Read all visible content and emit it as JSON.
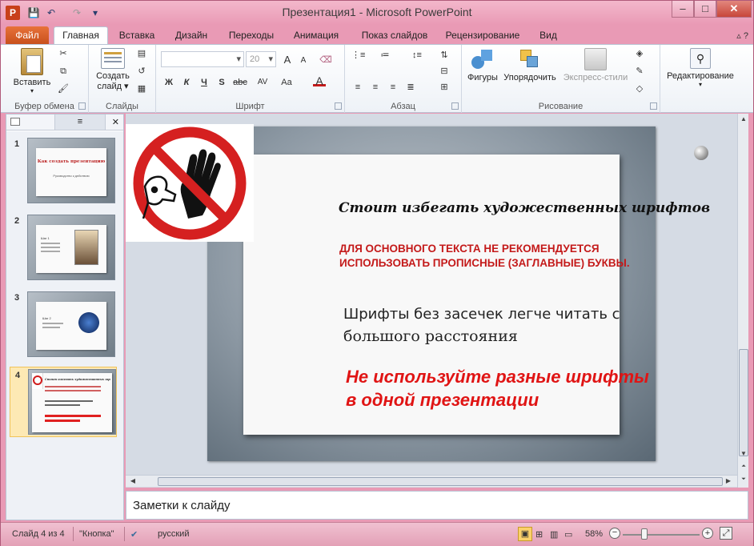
{
  "window": {
    "title": "Презентация1 - Microsoft PowerPoint",
    "app_icon": "P",
    "minimize": "–",
    "maximize": "□",
    "close": "✕"
  },
  "qat": {
    "save": "💾",
    "undo": "↶",
    "redo": "↷",
    "more": "▾"
  },
  "tabs": {
    "file": "Файл",
    "items": [
      "Главная",
      "Вставка",
      "Дизайн",
      "Переходы",
      "Анимация",
      "Показ слайдов",
      "Рецензирование",
      "Вид"
    ],
    "active": "Главная",
    "help_icons": "▵ ?"
  },
  "ribbon": {
    "clipboard": {
      "label": "Буфер обмена",
      "paste": "Вставить"
    },
    "slides": {
      "label": "Слайды",
      "new_slide_line1": "Создать",
      "new_slide_line2": "слайд ▾"
    },
    "font": {
      "label": "Шрифт",
      "size": "20",
      "bold": "Ж",
      "italic": "К",
      "underline": "Ч",
      "shadow": "S",
      "strike": "abc",
      "spacing": "AV",
      "case": "Aa",
      "color": "A",
      "grow": "A",
      "shrink": "A"
    },
    "paragraph": {
      "label": "Абзац"
    },
    "drawing": {
      "label": "Рисование",
      "shapes": "Фигуры",
      "arrange": "Упорядочить",
      "quick_styles": "Экспресс-стили"
    },
    "editing": {
      "label": "Редактирование"
    }
  },
  "panel": {
    "close": "✕",
    "slides": [
      {
        "num": "1",
        "title": "Как создать презентацию",
        "sub": "Руководство к действию"
      },
      {
        "num": "2",
        "title": "Шаг 1"
      },
      {
        "num": "3",
        "title": "Шаг 2"
      },
      {
        "num": "4",
        "title": "Стоит избегать художественных шрифтов"
      }
    ],
    "selected": "4"
  },
  "slide": {
    "heading": "Стоит избегать художественных шрифтов",
    "caps_line1": "ДЛЯ ОСНОВНОГО ТЕКСТА НЕ РЕКОМЕНДУЕТСЯ",
    "caps_line2": "ИСПОЛЬЗОВАТЬ ПРОПИСНЫЕ (ЗАГЛАВНЫЕ) БУКВЫ.",
    "sans_line1": "Шрифты без засечек легче читать с",
    "sans_line2": "большого расстояния",
    "warn_line1": "Не используйте разные шрифты",
    "warn_line2": "в одной презентации"
  },
  "notes": {
    "placeholder": "Заметки к слайду"
  },
  "status": {
    "slide_info": "Слайд 4 из 4",
    "theme": "\"Кнопка\"",
    "language": "русский",
    "zoom": "58%",
    "zoom_level": 0.58
  },
  "colors": {
    "title_bar": "#e99ab5",
    "file_tab": "#c8501c",
    "caps_text": "#c41a1a",
    "warn_text": "#e01414"
  }
}
